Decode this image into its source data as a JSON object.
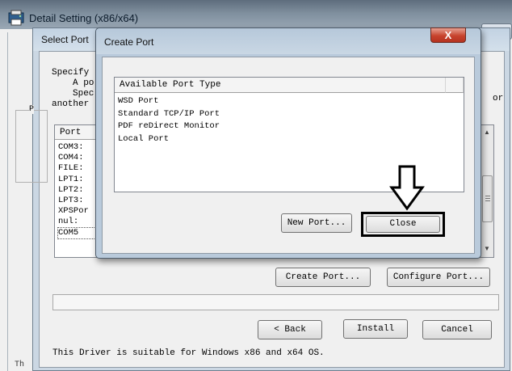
{
  "outer_window": {
    "title": "Detail Setting (x86/x64)",
    "close_label": "×",
    "footer_partial": "Th"
  },
  "select_port": {
    "title": "Select Port",
    "instructions": [
      "Specify",
      "A po",
      "Spec",
      "another"
    ],
    "left_partial": "P",
    "right_partial": "or",
    "port_column_header": "Port",
    "ports": [
      "COM3:",
      "COM4:",
      "FILE:",
      "LPT1:",
      "LPT2:",
      "LPT3:",
      "XPSPor",
      "nul:",
      "COM5"
    ],
    "create_port_button": "Create Port...",
    "configure_port_button": "Configure Port...",
    "back_button": "< Back",
    "install_button": "Install",
    "cancel_button": "Cancel",
    "driver_note": "This Driver is suitable for Windows x86 and x64 OS."
  },
  "create_port": {
    "title": "Create Port",
    "close_label": "X",
    "list_header": "Available Port Type",
    "port_types": [
      "WSD Port",
      "Standard TCP/IP Port",
      "PDF reDirect Monitor",
      "Local Port"
    ],
    "new_port_button": "New Port...",
    "close_button": "Close"
  },
  "colors": {
    "highlight_border": "#000000",
    "arrow_fill": "#ffffff",
    "arrow_stroke": "#000000"
  }
}
